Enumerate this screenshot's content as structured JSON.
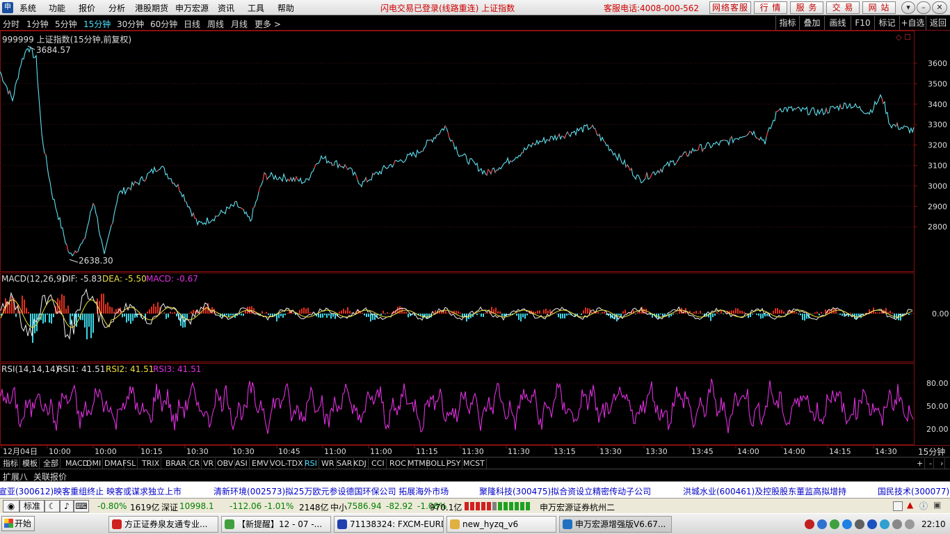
{
  "menubar": {
    "logo_text": "申",
    "items": [
      "系统",
      "功能",
      "报价",
      "分析",
      "港股期货",
      "申万宏源",
      "资讯",
      "工具",
      "帮助"
    ],
    "status": "闪电交易已登录(线路重连)   上证指数",
    "phone": "客服电话:4008-000-562",
    "buttons": [
      "网络客服",
      "行  情",
      "服  务",
      "交  易",
      "网  站"
    ],
    "window_buttons": [
      "▾",
      "–",
      "❐",
      "✕"
    ]
  },
  "periods": {
    "items": [
      "分时",
      "1分钟",
      "5分钟",
      "15分钟",
      "30分钟",
      "60分钟",
      "日线",
      "周线",
      "月线",
      "更多 >"
    ],
    "active_index": 3,
    "active_color": "#4ee0ff"
  },
  "right_tools": [
    "指标",
    "叠加",
    "画线",
    "F10",
    "标记",
    "+自选",
    "返回"
  ],
  "main_chart": {
    "title": "999999 上证指数(15分钟,前复权)",
    "max_label": "3684.57",
    "min_label": "2638.30",
    "y_ticks": [
      "3600",
      "3500",
      "3400",
      "3300",
      "3200",
      "3100",
      "3000",
      "2900",
      "2800"
    ]
  },
  "macd": {
    "name": "MACD(12,26,9)",
    "dif_label": "DIF: -5.83",
    "dea_label": "DEA: -5.50",
    "macd_label": "MACD: -0.67",
    "zero_label": "0.00"
  },
  "rsi": {
    "name": "RSI(14,14,14)",
    "rsi1_label": "RSI1: 41.51",
    "rsi2_label": "RSI2: 41.51",
    "rsi3_label": "RSI3: 41.51",
    "levels": [
      "80.00",
      "50.00",
      "20.00"
    ]
  },
  "time_axis": {
    "labels": [
      "12月04日",
      "10:00",
      "10:00",
      "10:15",
      "10:30",
      "10:30",
      "10:45",
      "11:00",
      "11:00",
      "11:15",
      "11:30",
      "11:30",
      "13:15",
      "13:30",
      "13:30",
      "13:45",
      "14:00",
      "14:00",
      "14:15",
      "14:30"
    ],
    "period_label": "15分钟"
  },
  "indicator_tabs": [
    "指标",
    "模板",
    "全部",
    "MACD",
    "DMI",
    "DMA",
    "FSL",
    "TRIX",
    "BRAR",
    "CR",
    "VR",
    "OBV",
    "ASI",
    "EMV",
    "VOL-TDX",
    "RSI",
    "WR",
    "SAR",
    "KDJ",
    "CCI",
    "ROC",
    "MTM",
    "BOLL",
    "PSY",
    "MCST"
  ],
  "indicator_tabs_active": "RSI",
  "tab_right_buttons": [
    "+",
    "-",
    "›"
  ],
  "ext_bar": [
    "扩展八",
    "关联报价"
  ],
  "ticker": [
    "宣亚(300612)映客重组终止 映客或谋求独立上市",
    "清新环境(002573)拟25万欧元参设德国环保公司 拓展海外市场",
    "聚隆科技(300475)拟合资设立精密传动子公司",
    "洪城水业(600461)及控股股东董监高拟增持",
    "国民技术(300077)"
  ],
  "index_bar": {
    "toggle_label": "标准",
    "sh_change": "-0.80%",
    "sh_amount": "1619亿",
    "sz_name": "深证",
    "sz_value": "10998.1",
    "sz_change": "-112.06",
    "sz_pct": "-1.01%",
    "sz_amount": "2148亿",
    "zx_name": "中小",
    "zx_value": "7586.94",
    "zx_change": "-82.92",
    "zx_pct": "-1.08%",
    "zx_amount": "970.1亿",
    "broker": "申万宏源证券杭州二"
  },
  "taskbar": {
    "start_label": "开始",
    "tasks": [
      "方正证券泉友通专业...",
      "【新提醒】12 - 07 -...",
      "71138324: FXCM-EURD...",
      "new_hyzq_v6",
      "申万宏源增强版V6.67..."
    ],
    "clock": "22:10"
  }
}
